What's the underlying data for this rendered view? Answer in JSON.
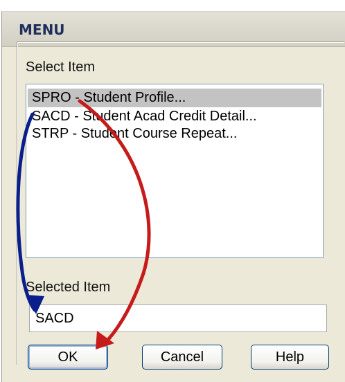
{
  "dialog": {
    "title": "MENU",
    "select_item_label": "Select Item",
    "items": [
      {
        "label": "SPRO - Student Profile...",
        "selected": true
      },
      {
        "label": "SACD - Student Acad Credit Detail...",
        "selected": false
      },
      {
        "label": "STRP - Student Course Repeat...",
        "selected": false
      }
    ],
    "selected_item_label": "Selected Item",
    "selected_item_value": "SACD",
    "buttons": {
      "ok": "OK",
      "cancel": "Cancel",
      "help": "Help"
    }
  },
  "colors": {
    "dialog_bg": "#ece9d8",
    "title_text": "#1f2f5c",
    "selection_bg": "#c3c3c3",
    "blue_arrow": "#0a1f8c",
    "red_arrow": "#c51b1b",
    "button_border": "#003c74"
  },
  "icons": {
    "annotation_arrow_blue": "curved-arrow-icon",
    "annotation_arrow_red": "curved-arrow-icon"
  }
}
